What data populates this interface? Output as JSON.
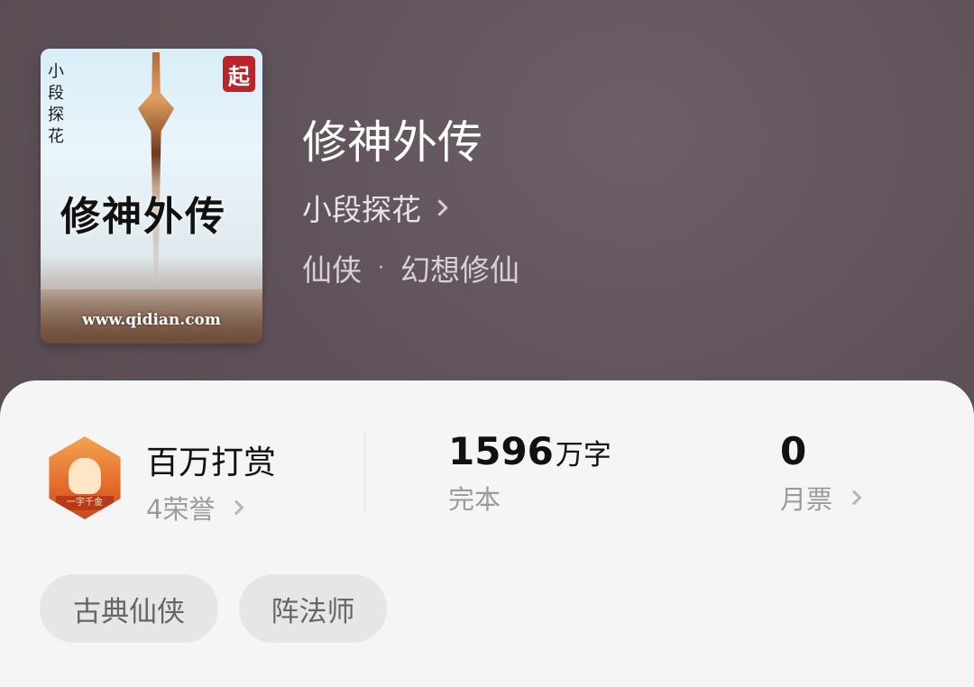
{
  "book": {
    "title": "修神外传",
    "author": "小段探花",
    "category": "仙侠",
    "subcategory": "幻想修仙",
    "genre_separator": "·"
  },
  "cover": {
    "vertical_author": "小段探花",
    "title_text": "修神外传",
    "logo_text": "起",
    "url_text": "www.qidian.com"
  },
  "stats": {
    "reward": {
      "title": "百万打赏",
      "honors": "4荣誉",
      "badge_ribbon": "一字千金"
    },
    "word_count": {
      "number": "1596",
      "unit": "万字",
      "status": "完本"
    },
    "monthly_tickets": {
      "number": "0",
      "label": "月票"
    }
  },
  "tags": [
    "古典仙侠",
    "阵法师"
  ],
  "colors": {
    "header_bg": "#5f5159",
    "card_bg": "#f5f5f5",
    "tag_bg": "#e6e6e6",
    "badge_orange": "#e36b2b"
  },
  "icons": {
    "chevron": "chevron-right-icon",
    "badge": "reward-badge-icon"
  }
}
